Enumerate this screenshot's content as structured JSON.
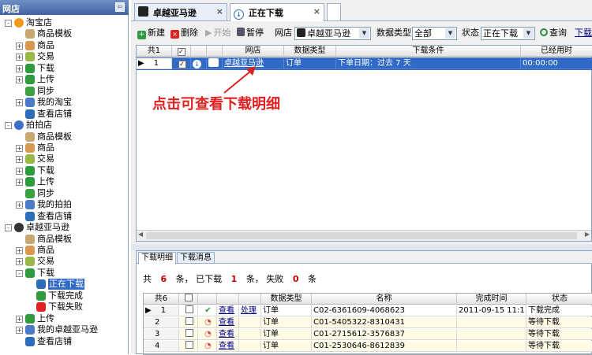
{
  "left": {
    "title": "网店",
    "tree": [
      {
        "label": "淘宝店",
        "lvl": 0,
        "exp": "-",
        "icon": "taobao-icon",
        "color": "#f39a1e"
      },
      {
        "label": "商品模板",
        "lvl": 1,
        "exp": "",
        "icon": "template-icon",
        "color": "#c8a870"
      },
      {
        "label": "商品",
        "lvl": 1,
        "exp": "+",
        "icon": "goods-icon",
        "color": "#d89a50"
      },
      {
        "label": "交易",
        "lvl": 1,
        "exp": "+",
        "icon": "trade-icon",
        "color": "#9ab848"
      },
      {
        "label": "下载",
        "lvl": 1,
        "exp": "+",
        "icon": "download-icon",
        "color": "#2f9a3e"
      },
      {
        "label": "上传",
        "lvl": 1,
        "exp": "+",
        "icon": "upload-icon",
        "color": "#2f9a3e"
      },
      {
        "label": "同步",
        "lvl": 1,
        "exp": "",
        "icon": "sync-icon",
        "color": "#3aa040"
      },
      {
        "label": "我的淘宝",
        "lvl": 1,
        "exp": "+",
        "icon": "network-icon",
        "color": "#4a7ac8"
      },
      {
        "label": "查看店铺",
        "lvl": 1,
        "exp": "",
        "icon": "globe-icon",
        "color": "#2d6cb8"
      },
      {
        "label": "拍拍店",
        "lvl": 0,
        "exp": "-",
        "icon": "paipai-icon",
        "color": "#3b6fc8"
      },
      {
        "label": "商品模板",
        "lvl": 1,
        "exp": "",
        "icon": "template-icon",
        "color": "#c8a870"
      },
      {
        "label": "商品",
        "lvl": 1,
        "exp": "+",
        "icon": "goods-icon",
        "color": "#d89a50"
      },
      {
        "label": "交易",
        "lvl": 1,
        "exp": "+",
        "icon": "trade-icon",
        "color": "#9ab848"
      },
      {
        "label": "下载",
        "lvl": 1,
        "exp": "+",
        "icon": "download-icon",
        "color": "#2f9a3e"
      },
      {
        "label": "上传",
        "lvl": 1,
        "exp": "+",
        "icon": "upload-icon",
        "color": "#2f9a3e"
      },
      {
        "label": "同步",
        "lvl": 1,
        "exp": "",
        "icon": "sync-icon",
        "color": "#3aa040"
      },
      {
        "label": "我的拍拍",
        "lvl": 1,
        "exp": "+",
        "icon": "network-icon",
        "color": "#4a7ac8"
      },
      {
        "label": "查看店铺",
        "lvl": 1,
        "exp": "",
        "icon": "globe-icon",
        "color": "#2d6cb8"
      },
      {
        "label": "卓越亚马逊",
        "lvl": 0,
        "exp": "-",
        "icon": "amazon-icon",
        "color": "#333"
      },
      {
        "label": "商品模板",
        "lvl": 1,
        "exp": "",
        "icon": "template-icon",
        "color": "#c8a870"
      },
      {
        "label": "商品",
        "lvl": 1,
        "exp": "+",
        "icon": "goods-icon",
        "color": "#d89a50"
      },
      {
        "label": "交易",
        "lvl": 1,
        "exp": "+",
        "icon": "trade-icon",
        "color": "#9ab848"
      },
      {
        "label": "下载",
        "lvl": 1,
        "exp": "-",
        "icon": "download-icon",
        "color": "#2f9a3e"
      },
      {
        "label": "正在下载",
        "lvl": 2,
        "exp": "",
        "icon": "downloading-icon",
        "color": "#2d6cb8",
        "selected": true
      },
      {
        "label": "下载完成",
        "lvl": 2,
        "exp": "",
        "icon": "check-icon",
        "color": "#2f9a3e"
      },
      {
        "label": "下载失败",
        "lvl": 2,
        "exp": "",
        "icon": "stop-icon",
        "color": "#d22"
      },
      {
        "label": "上传",
        "lvl": 1,
        "exp": "+",
        "icon": "upload-icon",
        "color": "#2f9a3e"
      },
      {
        "label": "我的卓越亚马逊",
        "lvl": 1,
        "exp": "+",
        "icon": "network-icon",
        "color": "#4a7ac8"
      },
      {
        "label": "查看店铺",
        "lvl": 1,
        "exp": "",
        "icon": "globe-icon",
        "color": "#2d6cb8"
      }
    ]
  },
  "tabs": [
    {
      "label": "卓越亚马逊",
      "close": "×"
    },
    {
      "label": "正在下载",
      "close": "×"
    }
  ],
  "toolbar": {
    "new": "新建",
    "delete": "删除",
    "start": "开始",
    "pause": "暂停",
    "shop_label": "网店",
    "shop_value": "卓越亚马逊",
    "type_label": "数据类型",
    "type_value": "全部",
    "status_label": "状态",
    "status_value": "正在下载",
    "query": "查询",
    "more": "下载"
  },
  "top_grid": {
    "count": "共1",
    "headers": [
      "网店",
      "数据类型",
      "下载条件",
      "已经用时"
    ],
    "row": {
      "num": "1",
      "shop": "卓越亚马逊",
      "type": "订单",
      "cond": "下单日期：过去 7 天",
      "time": "00:00:00"
    }
  },
  "annotation": "点击可查看下载明细",
  "bottom_tabs": [
    "下载明细",
    "下载消息"
  ],
  "summary": {
    "total_label": "共",
    "total": "6",
    "unit1": "条，",
    "done_label": "已下载",
    "done": "1",
    "unit2": "条，",
    "fail_label": "失败",
    "fail": "0",
    "unit3": "条"
  },
  "bottom_grid": {
    "count": "共6",
    "headers": [
      "数据类型",
      "名称",
      "完成时间",
      "状态"
    ],
    "rows": [
      {
        "num": "1",
        "view": "查看",
        "handle": "处理",
        "type": "订单",
        "name": "C02-6361609-4068623",
        "time": "2011-09-15 11:1...",
        "status": "下载完成",
        "done": true
      },
      {
        "num": "2",
        "view": "查看",
        "handle": "",
        "type": "订单",
        "name": "C01-5405322-8310431",
        "time": "",
        "status": "等待下载",
        "done": false
      },
      {
        "num": "3",
        "view": "查看",
        "handle": "",
        "type": "订单",
        "name": "C01-2715612-3576837",
        "time": "",
        "status": "等待下载",
        "done": false
      },
      {
        "num": "4",
        "view": "查看",
        "handle": "",
        "type": "订单",
        "name": "C01-2530646-8612839",
        "time": "",
        "status": "等待下载",
        "done": false
      }
    ]
  },
  "colors": {
    "accent": "#3169c6",
    "annotation": "#e02020",
    "count": "#c00000"
  }
}
